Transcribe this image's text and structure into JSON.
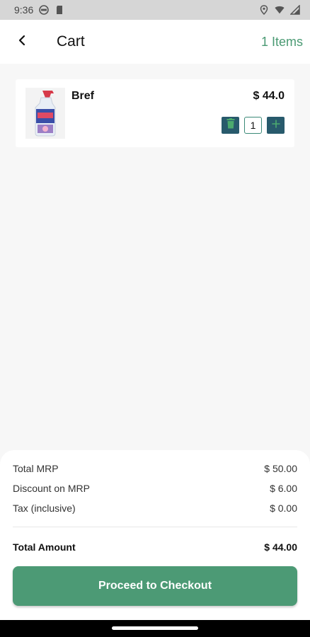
{
  "status_bar": {
    "time": "9:36",
    "icons_left": [
      "vpn-icon",
      "sim-card-icon"
    ],
    "icons_right": [
      "location-icon",
      "wifi-icon",
      "signal-icon"
    ]
  },
  "header": {
    "title": "Cart",
    "items_count": "1 Items",
    "accent_color": "#4a9a73"
  },
  "cart": {
    "items": [
      {
        "name": "Bref",
        "price": "$ 44.0",
        "quantity": "1",
        "image": "toilet-cleaner-bottle"
      }
    ]
  },
  "summary": {
    "rows": [
      {
        "label": "Total MRP",
        "value": "$ 50.00"
      },
      {
        "label": "Discount on MRP",
        "value": "$ 6.00"
      },
      {
        "label": "Tax (inclusive)",
        "value": "$ 0.00"
      }
    ],
    "total_label": "Total Amount",
    "total_value": "$ 44.00",
    "checkout_label": "Proceed to Checkout",
    "button_color": "#4c9a75"
  }
}
